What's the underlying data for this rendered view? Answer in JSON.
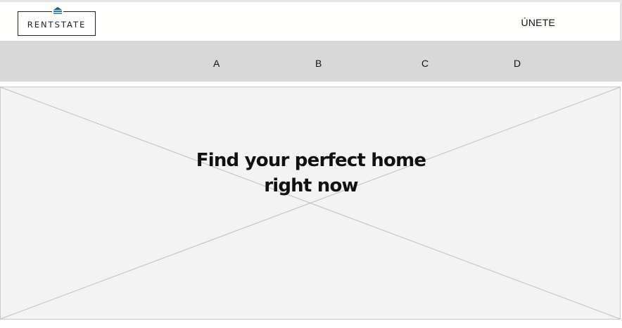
{
  "header": {
    "logo_text": "RENTSTATE",
    "join_label": "ÚNETE"
  },
  "nav": {
    "items": [
      "A",
      "B",
      "C",
      "D"
    ]
  },
  "hero": {
    "title_line1": "Find your perfect home",
    "title_line2": "right now"
  },
  "colors": {
    "header_bg": "#fdfdfc",
    "nav_bg": "#d8d8d8",
    "hero_bg": "#f3f3f3",
    "logo_icon": "#1d5a85"
  },
  "icons": {
    "logo": "house-roof-icon",
    "hero": "image-placeholder-icon"
  }
}
